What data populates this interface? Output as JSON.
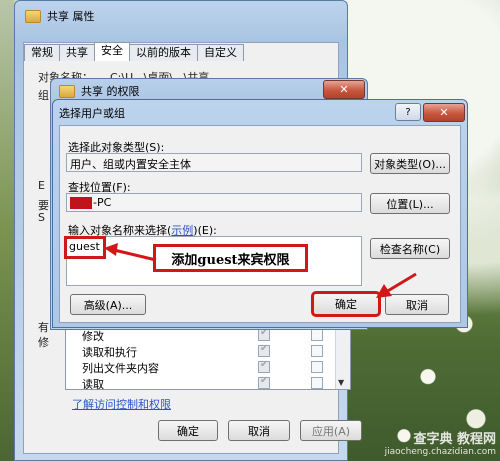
{
  "outer_window": {
    "title": "共享 属性",
    "tabs": [
      "常规",
      "共享",
      "安全",
      "以前的版本",
      "自定义"
    ],
    "active_tab": "安全",
    "fragments": [
      "对象名称：",
      "C:\\U...\\桌面\\...\\共享",
      "组",
      "E",
      "要",
      "S",
      "有",
      "修"
    ],
    "permissions": [
      {
        "label": "修改",
        "allow": true,
        "deny": false
      },
      {
        "label": "读取和执行",
        "allow": true,
        "deny": false
      },
      {
        "label": "列出文件夹内容",
        "allow": true,
        "deny": false
      },
      {
        "label": "读取",
        "allow": true,
        "deny": false
      }
    ],
    "link": "了解访问控制和权限",
    "ok": "确定",
    "cancel": "取消",
    "apply": "应用(A)"
  },
  "perm_window": {
    "title": "共享 的权限",
    "close_glyph": "✕"
  },
  "select_dialog": {
    "title": "选择用户或组",
    "help_glyph": "?",
    "close_glyph": "✕",
    "object_type_label": "选择此对象类型(S):",
    "object_type_value": "用户、组或内置安全主体",
    "object_type_button": "对象类型(O)...",
    "location_label": "查找位置(F):",
    "location_value": "-PC",
    "location_button": "位置(L)...",
    "names_label_prefix": "输入对象名称来选择(",
    "names_label_link": "示例",
    "names_label_suffix": ")(E):",
    "names_value": "guest",
    "check_names_button": "检查名称(C)",
    "advanced_button": "高级(A)...",
    "ok_button": "确定",
    "cancel_button": "取消"
  },
  "annotation": "添加guest来宾权限",
  "watermark": {
    "line1": "查字典 教程网",
    "line2": "jiaocheng.chazidian.com"
  },
  "colors": {
    "annotation_red": "#d01818"
  }
}
